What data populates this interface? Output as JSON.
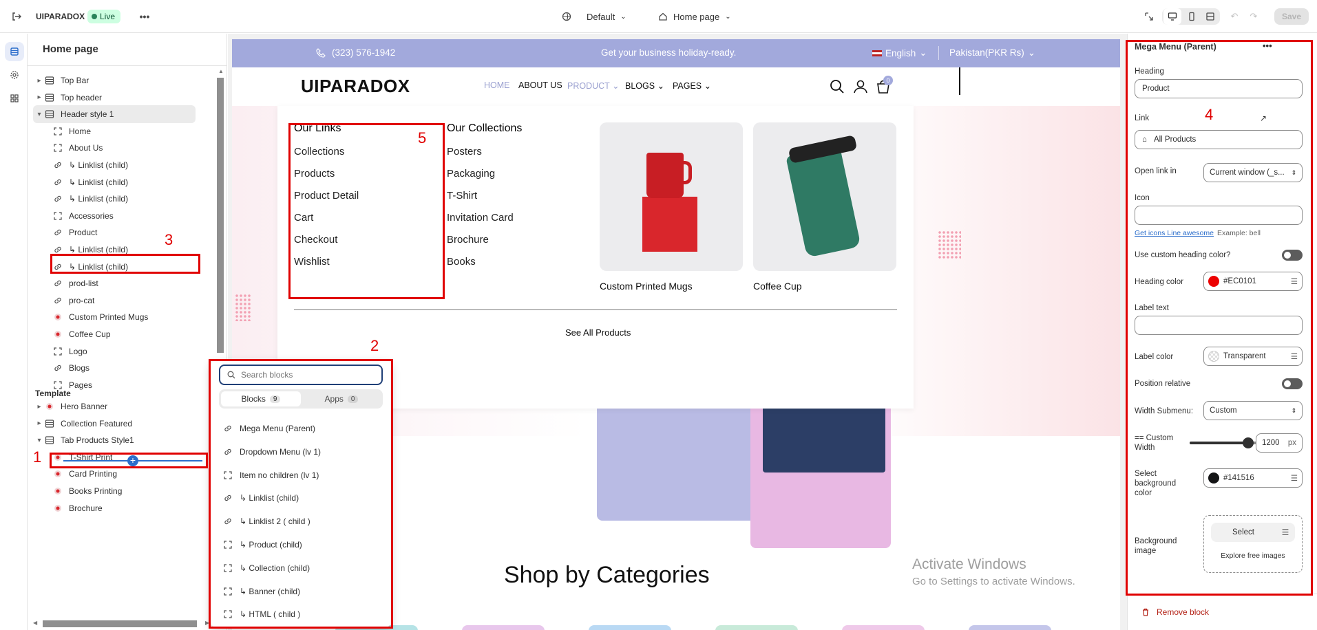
{
  "topbar": {
    "store_name": "UIPARADOX",
    "live_label": "Live",
    "theme_select": "Default",
    "page_select": "Home page",
    "save_label": "Save"
  },
  "left_panel": {
    "title": "Home page",
    "header_items": [
      {
        "label": "Top Bar",
        "icon": "section-icon",
        "chevron": "▸"
      },
      {
        "label": "Top header",
        "icon": "section-icon",
        "chevron": "▸"
      },
      {
        "label": "Header style 1",
        "icon": "section-icon",
        "chevron": "▾"
      }
    ],
    "header_children": [
      {
        "label": "Home",
        "icon": "block-icon"
      },
      {
        "label": "About Us",
        "icon": "block-icon"
      },
      {
        "label": "↳ Linklist (child)",
        "icon": "link-icon"
      },
      {
        "label": "↳ Linklist (child)",
        "icon": "link-icon"
      },
      {
        "label": "↳ Linklist (child)",
        "icon": "link-icon"
      },
      {
        "label": "Accessories",
        "icon": "block-icon"
      },
      {
        "label": "Product",
        "icon": "link-icon"
      },
      {
        "label": "↳ Linklist (child)",
        "icon": "link-icon"
      },
      {
        "label": "↳ Linklist (child)",
        "icon": "link-icon"
      },
      {
        "label": "prod-list",
        "icon": "link-icon"
      },
      {
        "label": "pro-cat",
        "icon": "link-icon"
      },
      {
        "label": "Custom Printed Mugs",
        "icon": "image-icon"
      },
      {
        "label": "Coffee Cup",
        "icon": "image-icon"
      },
      {
        "label": "Logo",
        "icon": "block-icon"
      },
      {
        "label": "Blogs",
        "icon": "link-icon"
      },
      {
        "label": "Pages",
        "icon": "block-icon"
      }
    ],
    "template_label": "Template",
    "template_items": [
      {
        "label": "Hero Banner",
        "icon": "image-icon",
        "chevron": "▸"
      },
      {
        "label": "Collection Featured",
        "icon": "section-icon",
        "chevron": "▸"
      },
      {
        "label": "Tab Products Style1",
        "icon": "section-icon",
        "chevron": "▾"
      }
    ],
    "template_children": [
      {
        "label": "T-Shirt Print"
      },
      {
        "label": "Card Printing"
      },
      {
        "label": "Books Printing"
      },
      {
        "label": "Brochure"
      }
    ]
  },
  "picker": {
    "search_placeholder": "Search blocks",
    "tab_blocks": "Blocks",
    "tab_blocks_count": "9",
    "tab_apps": "Apps",
    "tab_apps_count": "0",
    "items": [
      {
        "label": "Mega Menu (Parent)",
        "icon": "link-icon"
      },
      {
        "label": "Dropdown Menu (lv 1)",
        "icon": "link-icon"
      },
      {
        "label": "Item no children (lv 1)",
        "icon": "block-icon"
      },
      {
        "label": "↳ Linklist (child)",
        "icon": "link-icon"
      },
      {
        "label": "↳ Linklist 2 ( child )",
        "icon": "link-icon"
      },
      {
        "label": "↳ Product (child)",
        "icon": "block-icon"
      },
      {
        "label": "↳ Collection (child)",
        "icon": "block-icon"
      },
      {
        "label": "↳ Banner (child)",
        "icon": "block-icon"
      },
      {
        "label": "↳ HTML ( child )",
        "icon": "block-icon"
      }
    ]
  },
  "site": {
    "phone": "(323) 576-1942",
    "promo": "Get your business holiday-ready.",
    "language": "English",
    "currency": "Pakistan(PKR Rs)",
    "logo": "UIPARADOX",
    "nav": [
      "HOME",
      "ABOUT US",
      "PRODUCT",
      "BLOGS",
      "PAGES"
    ],
    "cart_count": "0",
    "mega": {
      "col1_title": "Our Links",
      "col1_links": [
        "Collections",
        "Products",
        "Product Detail",
        "Cart",
        "Checkout",
        "Wishlist"
      ],
      "col2_title": "Our Collections",
      "col2_links": [
        "Posters",
        "Packaging",
        "T-Shirt",
        "Invitation Card",
        "Brochure",
        "Books"
      ],
      "card1_title": "Custom Printed Mugs",
      "card2_title": "Coffee Cup",
      "see_all": "See All Products"
    },
    "shop_heading": "Shop by Categories",
    "watermark_1": "Activate Windows",
    "watermark_2": "Go to Settings to activate Windows."
  },
  "right_panel": {
    "title": "Mega Menu (Parent)",
    "heading_label": "Heading",
    "heading_value": "Product",
    "link_label": "Link",
    "link_value": "All Products",
    "open_link_label": "Open link in",
    "open_link_value": "Current window (_s...",
    "icon_label": "Icon",
    "icon_link": "Get icons Line awesome",
    "icon_hint": "Example: bell",
    "custom_heading_label": "Use custom heading color?",
    "heading_color_label": "Heading color",
    "heading_color_value": "#EC0101",
    "label_text_label": "Label text",
    "label_color_label": "Label color",
    "label_color_value": "Transparent",
    "position_relative_label": "Position relative",
    "width_submenu_label": "Width Submenu:",
    "width_submenu_value": "Custom",
    "custom_width_label": "== Custom Width",
    "custom_width_value": "1200",
    "custom_width_unit": "px",
    "custom_width_fraction": 0.85,
    "bg_color_label": "Select background color",
    "bg_color_value": "#141516",
    "bg_image_label": "Background image",
    "select_label": "Select",
    "explore_label": "Explore free images",
    "remove_label": "Remove block"
  },
  "annotations": [
    "1",
    "2",
    "3",
    "4",
    "5"
  ],
  "colors": {
    "accent_red": "#e00000",
    "heading_swatch": "#EC0101",
    "bg_swatch": "#141516",
    "promo_bar": "#a2a9dc"
  }
}
